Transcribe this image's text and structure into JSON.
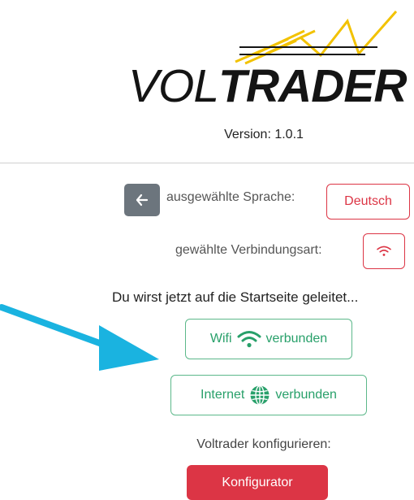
{
  "brand": {
    "name_part1": "VOL",
    "name_part2": "TRADER",
    "version": "Version: 1.0.1",
    "accent_color": "#f2c200",
    "line_color": "#141414"
  },
  "language": {
    "back_icon": "arrow-left-icon",
    "label": "ausgewählte Sprache:",
    "value": "Deutsch"
  },
  "connection": {
    "label": "gewählte Verbindungsart:",
    "icon": "wifi-icon"
  },
  "redirect_text": "Du wirst jetzt auf die Startseite geleitet...",
  "status": {
    "wifi": {
      "prefix": "Wifi",
      "icon": "wifi-icon",
      "suffix": "verbunden"
    },
    "internet": {
      "prefix": "Internet",
      "icon": "globe-icon",
      "suffix": "verbunden"
    }
  },
  "configure": {
    "label": "Voltrader konfigurieren:",
    "button": "Konfigurator"
  },
  "colors": {
    "danger": "#dc3545",
    "success": "#28a06a",
    "secondary": "#6c757d",
    "annotation_arrow": "#1ab3e0"
  }
}
